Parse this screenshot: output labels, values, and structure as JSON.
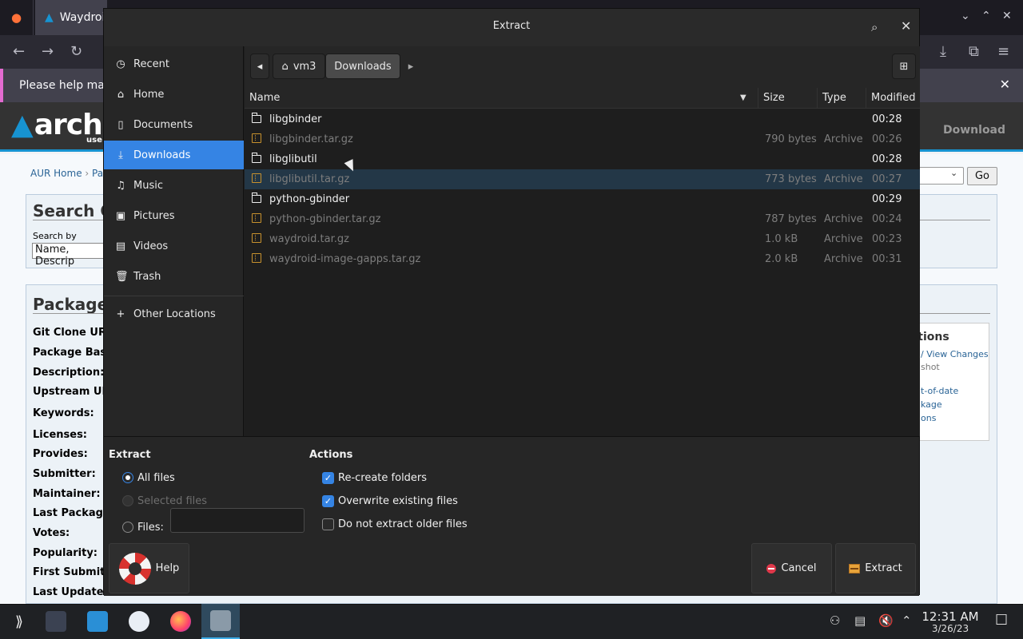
{
  "browser": {
    "tab_title": "Waydroi",
    "notice": "Please help make",
    "aur": {
      "logo_text": "arch",
      "logo_sub": "use",
      "download": "Download",
      "crumb_home": "AUR Home",
      "crumb_pkg": "Pac",
      "go": "Go",
      "search_title": "Search Cr",
      "search_by": "Search by",
      "search_by_value": "Name, Descrip",
      "package_title": "Package",
      "labels": [
        "Git Clone URL",
        "Package Base",
        "Description:",
        "Upstream URL",
        "Keywords:",
        "Licenses:",
        "Provides:",
        "Submitter:",
        "Maintainer:",
        "Last Packager",
        "Votes:",
        "Popularity:",
        "First Submitte",
        "Last Updated"
      ],
      "actions_title": "ctions",
      "action_links": [
        "/ View Changes",
        "shot",
        "t-of-date",
        "kage",
        "ons"
      ]
    }
  },
  "dialog": {
    "title": "Extract",
    "sidebar": [
      {
        "label": "Recent",
        "icon": "clock-icon"
      },
      {
        "label": "Home",
        "icon": "home-icon"
      },
      {
        "label": "Documents",
        "icon": "document-icon"
      },
      {
        "label": "Downloads",
        "icon": "download-icon"
      },
      {
        "label": "Music",
        "icon": "music-icon"
      },
      {
        "label": "Pictures",
        "icon": "picture-icon"
      },
      {
        "label": "Videos",
        "icon": "video-icon"
      },
      {
        "label": "Trash",
        "icon": "trash-icon"
      },
      {
        "label": "Other Locations",
        "icon": "plus-icon"
      }
    ],
    "pathbar": {
      "home": "vm3",
      "current": "Downloads"
    },
    "columns": {
      "name": "Name",
      "size": "Size",
      "type": "Type",
      "modified": "Modified"
    },
    "files": [
      {
        "name": "libgbinder",
        "size": "",
        "type": "",
        "modified": "00:28",
        "kind": "folder"
      },
      {
        "name": "libgbinder.tar.gz",
        "size": "790 bytes",
        "type": "Archive",
        "modified": "00:26",
        "kind": "archive"
      },
      {
        "name": "libglibutil",
        "size": "",
        "type": "",
        "modified": "00:28",
        "kind": "folder"
      },
      {
        "name": "libglibutil.tar.gz",
        "size": "773 bytes",
        "type": "Archive",
        "modified": "00:27",
        "kind": "archive"
      },
      {
        "name": "python-gbinder",
        "size": "",
        "type": "",
        "modified": "00:29",
        "kind": "folder"
      },
      {
        "name": "python-gbinder.tar.gz",
        "size": "787 bytes",
        "type": "Archive",
        "modified": "00:24",
        "kind": "archive"
      },
      {
        "name": "waydroid.tar.gz",
        "size": "1.0 kB",
        "type": "Archive",
        "modified": "00:23",
        "kind": "archive"
      },
      {
        "name": "waydroid-image-gapps.tar.gz",
        "size": "2.0 kB",
        "type": "Archive",
        "modified": "00:31",
        "kind": "archive"
      }
    ],
    "options": {
      "extract_title": "Extract",
      "all_files": "All files",
      "selected_files": "Selected files",
      "files_label": "Files:",
      "files_value": "",
      "actions_title": "Actions",
      "recreate_folders": "Re-create folders",
      "overwrite": "Overwrite existing files",
      "no_older": "Do not extract older files"
    },
    "buttons": {
      "help": "Help",
      "cancel": "Cancel",
      "extract": "Extract"
    }
  },
  "taskbar": {
    "time": "12:31 AM",
    "date": "3/26/23"
  }
}
